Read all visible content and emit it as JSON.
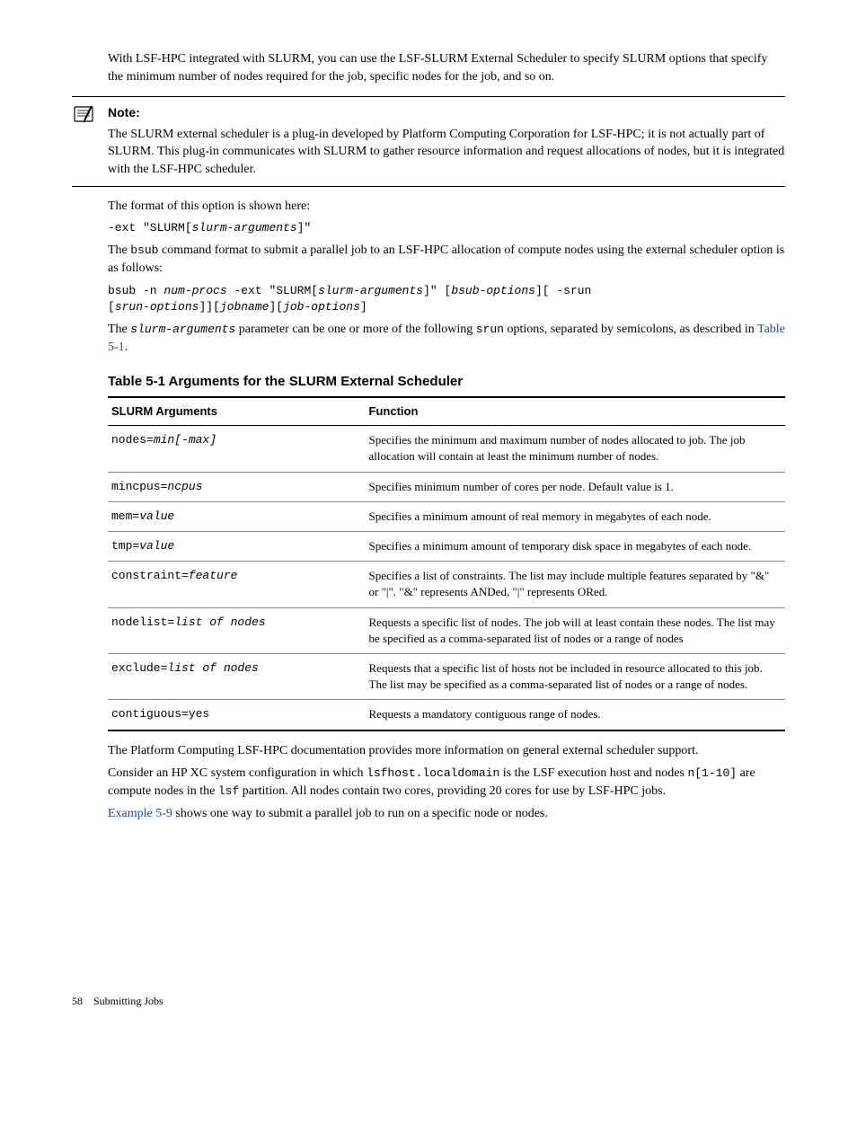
{
  "intro": "With LSF-HPC integrated with SLURM, you can use the LSF-SLURM External Scheduler to specify SLURM options that specify the minimum number of nodes required for the job, specific nodes for the job, and so on.",
  "note": {
    "heading": "Note:",
    "body": "The SLURM external scheduler is a plug-in developed by Platform Computing Corporation for LSF-HPC; it is not actually part of SLURM. This plug-in communicates with SLURM to gather resource information and request allocations of nodes, but it is integrated with the LSF-HPC scheduler."
  },
  "format_intro": "The format of this option is shown here:",
  "format_code": "-ext \"SLURM[slurm-arguments]\"",
  "bsub_intro_1": "The ",
  "bsub_intro_code1": "bsub",
  "bsub_intro_2": " command format to submit a parallel job to an LSF-HPC allocation of compute nodes using the external scheduler option is as follows:",
  "bsub_code_line1_a": "bsub -n ",
  "bsub_code_line1_b": "num-procs",
  "bsub_code_line1_c": " -ext \"SLURM[",
  "bsub_code_line1_d": "slurm-arguments",
  "bsub_code_line1_e": "]\" [",
  "bsub_code_line1_f": "bsub-options",
  "bsub_code_line1_g": "][ -srun ",
  "bsub_code_line2_a": "[",
  "bsub_code_line2_b": "srun-options",
  "bsub_code_line2_c": "]][",
  "bsub_code_line2_d": "jobname",
  "bsub_code_line2_e": "][",
  "bsub_code_line2_f": "job-options",
  "bsub_code_line2_g": "]",
  "slurm_args_1": "The ",
  "slurm_args_code": "slurm-arguments",
  "slurm_args_2": " parameter can be one or more of the following ",
  "slurm_args_code2": "srun",
  "slurm_args_3": " options, separated by semicolons, as described in ",
  "slurm_args_link": "Table 5-1",
  "slurm_args_4": ".",
  "table_title": "Table  5-1  Arguments for the SLURM External Scheduler",
  "table": {
    "header_arg": "SLURM Arguments",
    "header_func": "Function",
    "rows": [
      {
        "arg_p": "nodes=",
        "arg_i": "min[-max]",
        "func": "Specifies the minimum and maximum number of nodes allocated to job. The job allocation will contain at least the minimum number of nodes."
      },
      {
        "arg_p": "mincpus=",
        "arg_i": "ncpus",
        "func": "Specifies minimum number of cores per node. Default value is 1."
      },
      {
        "arg_p": "mem=",
        "arg_i": "value",
        "func": "Specifies a minimum amount of real memory in megabytes of each node."
      },
      {
        "arg_p": "tmp=",
        "arg_i": "value",
        "func": "Specifies a minimum amount of temporary disk space in megabytes of each node."
      },
      {
        "arg_p": "constraint=",
        "arg_i": "feature",
        "func": "Specifies a list of constraints. The list may include multiple features separated by \"&\" or \"|\". \"&\" represents ANDed, \"|\" represents ORed."
      },
      {
        "arg_p": "nodelist=",
        "arg_i": "list of nodes",
        "func": "Requests a specific list of nodes. The job will at least contain these nodes. The list may be specified as a comma-separated list of nodes or a range of nodes"
      },
      {
        "arg_p": "exclude=",
        "arg_i": "list of nodes",
        "func": "Requests that a specific list of hosts not be included in resource allocated to this job. The list may be specified as a comma-separated list of nodes or a range of nodes."
      },
      {
        "arg_p": "contiguous=yes",
        "arg_i": "",
        "func": "Requests a mandatory contiguous range of nodes."
      }
    ]
  },
  "after_table_1": "The Platform Computing LSF-HPC documentation provides more information on general external scheduler support.",
  "after_table_2a": "Consider an HP XC system configuration in which ",
  "after_table_2b": "lsfhost.localdomain",
  "after_table_2c": " is the LSF execution host and nodes ",
  "after_table_2d": "n[1-10]",
  "after_table_2e": " are compute nodes in the ",
  "after_table_2f": "lsf",
  "after_table_2g": " partition. All nodes contain two cores, providing 20 cores for use by LSF-HPC jobs.",
  "example_link": "Example 5-9",
  "example_text": " shows one way to submit a parallel job to run on a specific node or nodes.",
  "footer_page": "58",
  "footer_chapter": "Submitting Jobs"
}
